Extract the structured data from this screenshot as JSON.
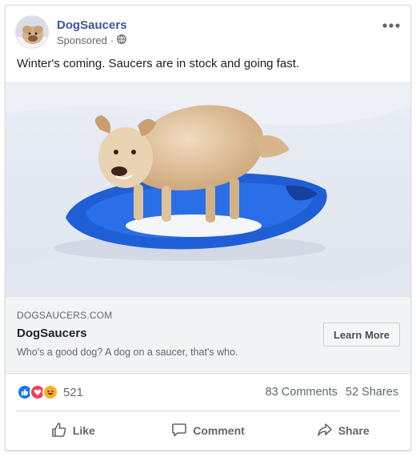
{
  "post": {
    "page_name": "DogSaucers",
    "sponsored_label": "Sponsored",
    "separator": "·",
    "text": "Winter's coming. Saucers are in stock and going fast."
  },
  "link_preview": {
    "domain": "DOGSAUCERS.COM",
    "title": "DogSaucers",
    "description": "Who's a good dog? A dog on a saucer, that's who.",
    "cta_label": "Learn More"
  },
  "engagement": {
    "reactions": [
      "like-icon",
      "love-icon",
      "haha-icon"
    ],
    "reaction_count": "521",
    "comments": "83 Comments",
    "shares": "52 Shares"
  },
  "actions": {
    "like": "Like",
    "comment": "Comment",
    "share": "Share"
  },
  "colors": {
    "page_name": "#385898",
    "like_blue": "#1877f2",
    "love_red": "#f33e58",
    "haha_yellow": "#f7b125",
    "saucer_blue": "#1f5fd6"
  }
}
